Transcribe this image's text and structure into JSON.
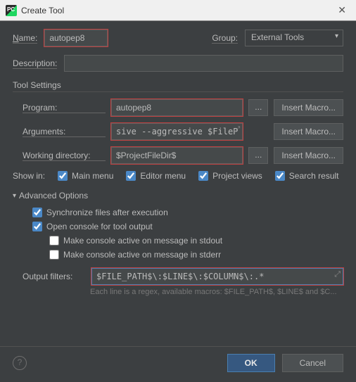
{
  "window": {
    "title": "Create Tool"
  },
  "form": {
    "name_label": "Name:",
    "name_value": "autopep8",
    "group_label": "Group:",
    "group_value": "External Tools",
    "description_label": "Description:",
    "description_value": ""
  },
  "tool_settings": {
    "heading": "Tool Settings",
    "program_label": "Program:",
    "program_value": "autopep8",
    "arguments_label": "Arguments:",
    "arguments_value": "sive --aggressive $FilePath$",
    "workdir_label": "Working directory:",
    "workdir_value": "$ProjectFileDir$",
    "browse_label": "...",
    "insert_macro_label": "Insert Macro..."
  },
  "show_in": {
    "label": "Show in:",
    "main_menu": "Main menu",
    "editor_menu": "Editor menu",
    "project_views": "Project views",
    "search_result": "Search result"
  },
  "advanced": {
    "heading": "Advanced Options",
    "sync": "Synchronize files after execution",
    "open_console": "Open console for tool output",
    "stdout": "Make console active on message in stdout",
    "stderr": "Make console active on message in stderr",
    "output_filters_label": "Output filters:",
    "output_filters_value": "$FILE_PATH$\\:$LINE$\\:$COLUMN$\\:.*",
    "hint": "Each line is a regex, available macros: $FILE_PATH$, $LINE$ and $C..."
  },
  "footer": {
    "ok": "OK",
    "cancel": "Cancel"
  }
}
